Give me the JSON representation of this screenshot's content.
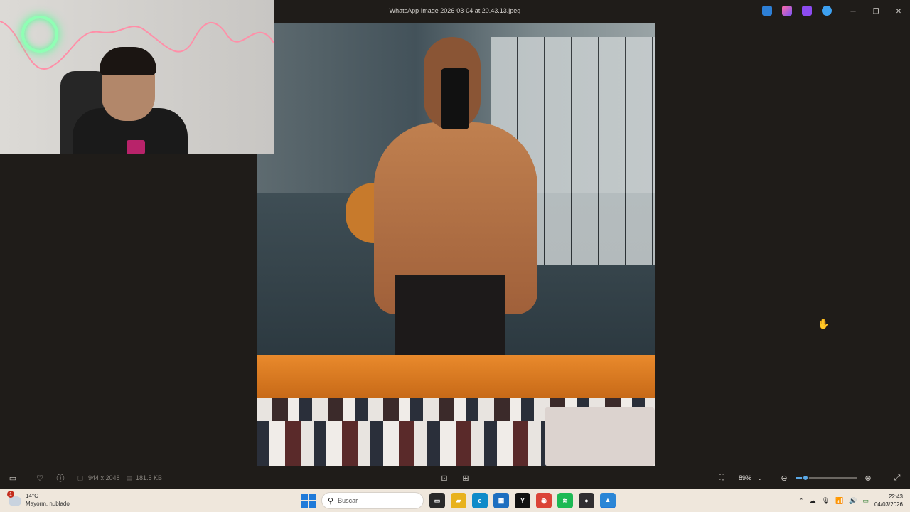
{
  "window": {
    "title": "WhatsApp Image 2026-03-04 at 20.43.13.jpeg",
    "app_icons": [
      "edit-icon",
      "copilot-icon",
      "clipchamp-icon",
      "onedrive-icon"
    ],
    "controls": {
      "minimize": "─",
      "maximize": "❐",
      "close": "✕"
    }
  },
  "viewer_toolbar": {
    "dimensions": "944 x 2048",
    "file_size": "181.5 KB",
    "zoom_label": "89%",
    "zoom_level": 0.15
  },
  "taskbar": {
    "weather": {
      "badge": "1",
      "temperature": "14°C",
      "condition": "Mayorm. nublado"
    },
    "search_placeholder": "Buscar",
    "apps": [
      {
        "name": "task-view",
        "glyph": "▭",
        "color": "#2a2a2a"
      },
      {
        "name": "file-explorer",
        "glyph": "▰",
        "color": "#e8b21d"
      },
      {
        "name": "edge",
        "glyph": "e",
        "color": "#0f8bc9"
      },
      {
        "name": "microsoft-store",
        "glyph": "▦",
        "color": "#1d6fc0"
      },
      {
        "name": "y-app",
        "glyph": "Y",
        "color": "#111111"
      },
      {
        "name": "chrome",
        "glyph": "◉",
        "color": "#db4437"
      },
      {
        "name": "spotify",
        "glyph": "≋",
        "color": "#1db954"
      },
      {
        "name": "obs",
        "glyph": "●",
        "color": "#302e31"
      },
      {
        "name": "photos",
        "glyph": "▲",
        "color": "#2b86d6"
      }
    ],
    "clock_time": "22:43",
    "clock_date": "04/03/2026"
  },
  "colors": {
    "accent": "#5aa8e6",
    "titlebar_bg": "#1f1c19",
    "taskbar_bg": "#efe7dc"
  }
}
